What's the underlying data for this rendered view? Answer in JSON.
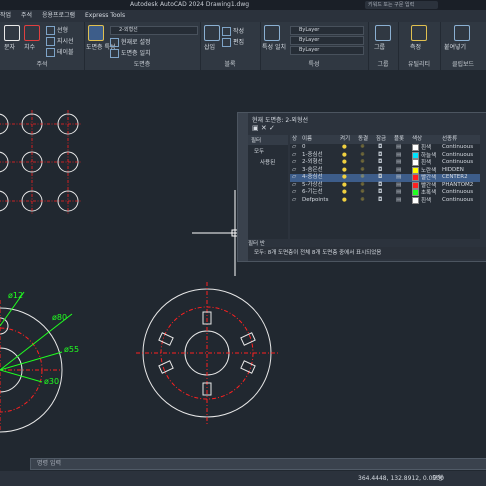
{
  "window": {
    "title": "Autodesk AutoCAD 2024   Drawing1.dwg",
    "search_placeholder": "키워드 또는 구문 입력"
  },
  "menubar": {
    "items": [
      "작업",
      "주석",
      "응용프로그램",
      "Express Tools"
    ]
  },
  "ribbon": {
    "panels": [
      {
        "label": "주석"
      },
      {
        "label": "도면층"
      },
      {
        "label": "블록"
      },
      {
        "label": "특성"
      },
      {
        "label": "그룹"
      },
      {
        "label": "유틸리티"
      },
      {
        "label": "클립보드"
      }
    ],
    "buttons": {
      "text": "문자",
      "dimension": "치수",
      "leader": "지시선",
      "table": "테이블",
      "line_type": "선형",
      "layer_props": "도면층 특성",
      "current_layer": "2-외형선",
      "match_layer": "현재로 설정",
      "match_props": "도면층 일치",
      "insert": "삽입",
      "create": "작성",
      "edit": "편집",
      "match": "특성 일치",
      "bylayer1": "ByLayer",
      "bylayer2": "ByLayer",
      "bylayer3": "ByLayer",
      "group": "그룹",
      "measure": "측정",
      "paste": "붙여넣기"
    }
  },
  "layer_dialog": {
    "title": "현재 도면층: 2-외형선",
    "filter_label": "필터",
    "filter_items": [
      "모두",
      "사용된"
    ],
    "columns": [
      "상",
      "이름",
      "켜기",
      "동결",
      "잠금",
      "플롯",
      "색상",
      "선종류"
    ],
    "rows": [
      {
        "name": "0",
        "color": "흰색",
        "color_hex": "#ffffff",
        "linetype": "Continuous",
        "selected": false
      },
      {
        "name": "1-중심선",
        "color": "하늘색",
        "color_hex": "#00e5ff",
        "linetype": "Continuous",
        "selected": false
      },
      {
        "name": "2-외형선",
        "color": "흰색",
        "color_hex": "#ffffff",
        "linetype": "Continuous",
        "selected": false
      },
      {
        "name": "3-숨은선",
        "color": "노란색",
        "color_hex": "#ffff00",
        "linetype": "HIDDEN",
        "selected": false
      },
      {
        "name": "4-중심선",
        "color": "빨간색",
        "color_hex": "#ff2020",
        "linetype": "CENTER2",
        "selected": true
      },
      {
        "name": "5-가상선",
        "color": "빨간색",
        "color_hex": "#ff2020",
        "linetype": "PHANTOM2",
        "selected": false
      },
      {
        "name": "6-기는선",
        "color": "초록색",
        "color_hex": "#20ff20",
        "linetype": "Continuous",
        "selected": false
      },
      {
        "name": "Defpoints",
        "color": "흰색",
        "color_hex": "#ffffff",
        "linetype": "Continuous",
        "selected": false
      }
    ],
    "search_label": "필터 반",
    "status": "모두: 8개 도면층이 전체 8개 도면층 중에서 표시되었음"
  },
  "drawing": {
    "dims": [
      "ø12",
      "ø80",
      "ø55",
      "ø30"
    ]
  },
  "command_line": {
    "placeholder": "명령 입력"
  },
  "statusbar": {
    "coords": "364.4448, 132.8912, 0.0000",
    "mode": "모형"
  },
  "colors": {
    "accent": "#3d5d8a",
    "center_line": "#ff2020",
    "dimension": "#20ff20",
    "outline": "#ffffff"
  }
}
